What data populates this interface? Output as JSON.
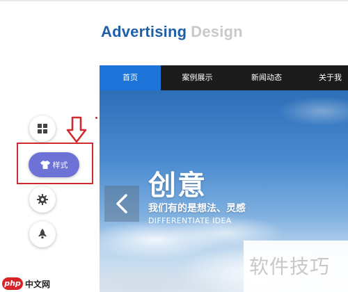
{
  "brand": {
    "title_primary": "Advertising",
    "title_secondary": "Design"
  },
  "nav": {
    "items": [
      "首页",
      "案例展示",
      "新闻动态",
      "关于我"
    ],
    "active_index": 0
  },
  "banner": {
    "headline": "创意",
    "subtitle": "我们有的是想法、灵感",
    "english": "DIFFERENTIATE IDEA",
    "watermark": "软件技巧"
  },
  "toolbar": {
    "style_button_label": "样式"
  },
  "logo": {
    "badge_text": "php",
    "text": "中文网"
  },
  "icons": {
    "grid": "grid-icon",
    "shirt": "shirt-icon",
    "gear": "gear-icon",
    "rocket": "rocket-icon",
    "prev": "chevron-left-icon",
    "annotation": "arrow-down-icon"
  },
  "colors": {
    "brand_blue": "#1f5fa7",
    "nav_active": "#1d74d8",
    "nav_bg": "#1b1b1b",
    "style_button": "#6c72d6",
    "annotation_red": "#d0292f"
  }
}
